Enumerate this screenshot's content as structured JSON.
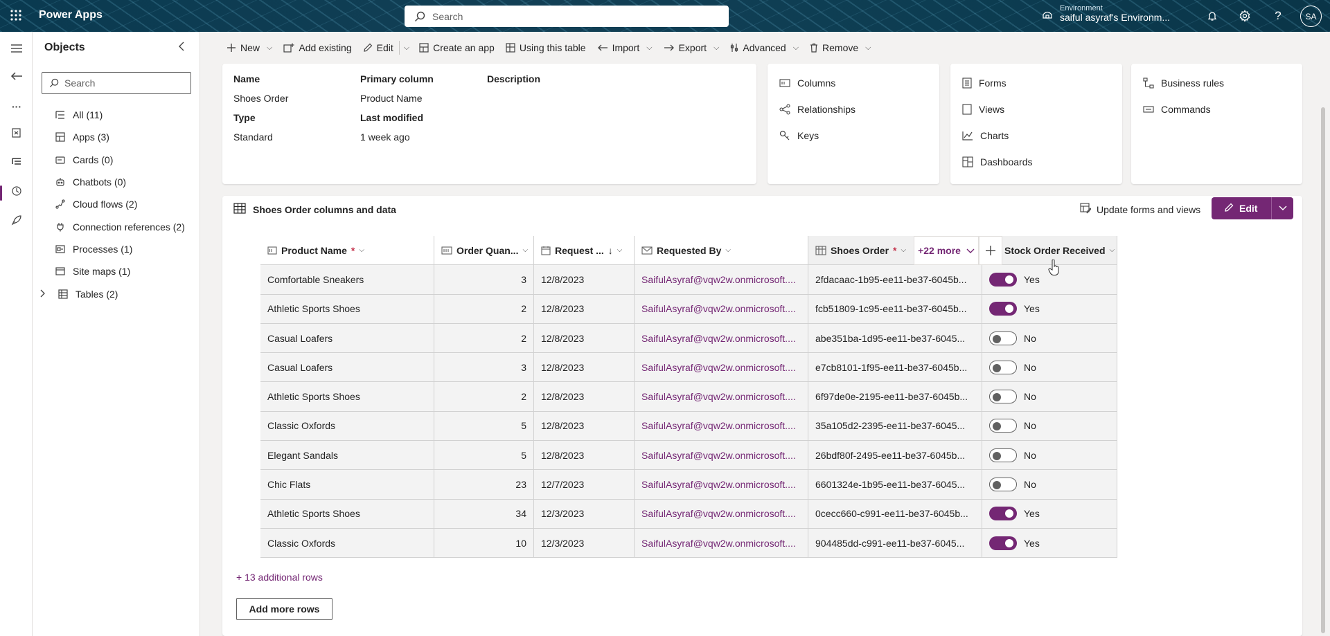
{
  "app": {
    "brand": "Power Apps"
  },
  "topbar": {
    "search_placeholder": "Search",
    "environment_label": "Environment",
    "environment_name": "saiful asyraf's Environm...",
    "avatar_initials": "SA"
  },
  "objects": {
    "title": "Objects",
    "search_placeholder": "Search",
    "items": [
      {
        "label": "All",
        "count": "(11)"
      },
      {
        "label": "Apps",
        "count": "(3)"
      },
      {
        "label": "Cards",
        "count": "(0)"
      },
      {
        "label": "Chatbots",
        "count": "(0)"
      },
      {
        "label": "Cloud flows",
        "count": "(2)"
      },
      {
        "label": "Connection references",
        "count": "(2)"
      },
      {
        "label": "Processes",
        "count": "(1)"
      },
      {
        "label": "Site maps",
        "count": "(1)"
      },
      {
        "label": "Tables",
        "count": "(2)"
      }
    ]
  },
  "commands": {
    "new": "New",
    "add_existing": "Add existing",
    "edit": "Edit",
    "create_app": "Create an app",
    "using_table": "Using this table",
    "import": "Import",
    "export": "Export",
    "advanced": "Advanced",
    "remove": "Remove"
  },
  "properties": {
    "name_label": "Name",
    "name_value": "Shoes Order",
    "primary_label": "Primary column",
    "primary_value": "Product Name",
    "description_label": "Description",
    "type_label": "Type",
    "type_value": "Standard",
    "modified_label": "Last modified",
    "modified_value": "1 week ago"
  },
  "schema": {
    "columns": "Columns",
    "relationships": "Relationships",
    "keys": "Keys"
  },
  "data_experiences": {
    "forms": "Forms",
    "views": "Views",
    "charts": "Charts",
    "dashboards": "Dashboards"
  },
  "customizations": {
    "business_rules": "Business rules",
    "commands": "Commands"
  },
  "data_section": {
    "title": "Shoes Order columns and data",
    "update_label": "Update forms and views",
    "edit_label": "Edit",
    "columns": {
      "product": "Product Name",
      "quantity": "Order Quan...",
      "request": "Request ...",
      "requested_by": "Requested By",
      "shoes_order": "Shoes Order",
      "stock": "Stock Order Received"
    },
    "more_columns": "+22 more",
    "rows": [
      {
        "product": "Comfortable Sneakers",
        "qty": "3",
        "date": "12/8/2023",
        "by": "SaifulAsyraf@vqw2w.onmicrosoft....",
        "id": "2fdacaac-1b95-ee11-be37-6045b...",
        "on": true,
        "status": "Yes"
      },
      {
        "product": "Athletic Sports Shoes",
        "qty": "2",
        "date": "12/8/2023",
        "by": "SaifulAsyraf@vqw2w.onmicrosoft....",
        "id": "fcb51809-1c95-ee11-be37-6045b...",
        "on": true,
        "status": "Yes"
      },
      {
        "product": "Casual Loafers",
        "qty": "2",
        "date": "12/8/2023",
        "by": "SaifulAsyraf@vqw2w.onmicrosoft....",
        "id": "abe351ba-1d95-ee11-be37-6045...",
        "on": false,
        "status": "No"
      },
      {
        "product": "Casual Loafers",
        "qty": "3",
        "date": "12/8/2023",
        "by": "SaifulAsyraf@vqw2w.onmicrosoft....",
        "id": "e7cb8101-1f95-ee11-be37-6045b...",
        "on": false,
        "status": "No"
      },
      {
        "product": "Athletic Sports Shoes",
        "qty": "2",
        "date": "12/8/2023",
        "by": "SaifulAsyraf@vqw2w.onmicrosoft....",
        "id": "6f97de0e-2195-ee11-be37-6045b...",
        "on": false,
        "status": "No"
      },
      {
        "product": "Classic Oxfords",
        "qty": "5",
        "date": "12/8/2023",
        "by": "SaifulAsyraf@vqw2w.onmicrosoft....",
        "id": "35a105d2-2395-ee11-be37-6045...",
        "on": false,
        "status": "No"
      },
      {
        "product": "Elegant Sandals",
        "qty": "5",
        "date": "12/8/2023",
        "by": "SaifulAsyraf@vqw2w.onmicrosoft....",
        "id": "26bdf80f-2495-ee11-be37-6045b...",
        "on": false,
        "status": "No"
      },
      {
        "product": "Chic Flats",
        "qty": "23",
        "date": "12/7/2023",
        "by": "SaifulAsyraf@vqw2w.onmicrosoft....",
        "id": "6601324e-1b95-ee11-be37-6045...",
        "on": false,
        "status": "No"
      },
      {
        "product": "Athletic Sports Shoes",
        "qty": "34",
        "date": "12/3/2023",
        "by": "SaifulAsyraf@vqw2w.onmicrosoft....",
        "id": "0cecc660-c991-ee11-be37-6045b...",
        "on": true,
        "status": "Yes"
      },
      {
        "product": "Classic Oxfords",
        "qty": "10",
        "date": "12/3/2023",
        "by": "SaifulAsyraf@vqw2w.onmicrosoft....",
        "id": "904485dd-c991-ee11-be37-6045...",
        "on": true,
        "status": "Yes"
      }
    ],
    "additional_rows": "+ 13 additional rows",
    "add_more_rows": "Add more rows"
  }
}
